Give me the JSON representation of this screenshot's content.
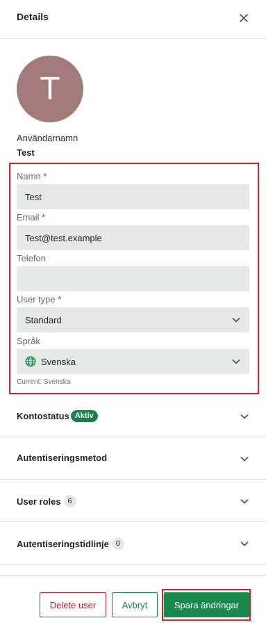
{
  "header": {
    "title": "Details",
    "close_icon": "close-icon"
  },
  "avatar": {
    "initial": "T",
    "color": "#a37b78"
  },
  "username": {
    "label": "Användarnamn",
    "value": "Test"
  },
  "form": {
    "name": {
      "label": "Namn",
      "required": "*",
      "value": "Test"
    },
    "email": {
      "label": "Email",
      "required": "*",
      "value": "Test@test.example"
    },
    "phone": {
      "label": "Telefon",
      "value": ""
    },
    "user_type": {
      "label": "User type",
      "required": "*",
      "value": "Standard"
    },
    "language": {
      "label": "Språk",
      "value": "Svenska",
      "hint": "Current: Svenska",
      "icon": "globe-icon"
    }
  },
  "sections": {
    "account_status": {
      "label": "Kontostatus",
      "badge": "Aktiv"
    },
    "auth_method": {
      "label": "Autentiseringsmetod"
    },
    "user_roles": {
      "label": "User roles",
      "count": "6"
    },
    "auth_timeline": {
      "label": "Autentiseringstidlinje",
      "count": "0"
    }
  },
  "footer": {
    "delete_label": "Delete user",
    "cancel_label": "Avbryt",
    "save_label": "Spara ändringar"
  },
  "colors": {
    "primary_green": "#168a4a",
    "danger_red": "#b3202a",
    "highlight_red": "#d0202a",
    "field_bg": "#e6e8e7"
  }
}
